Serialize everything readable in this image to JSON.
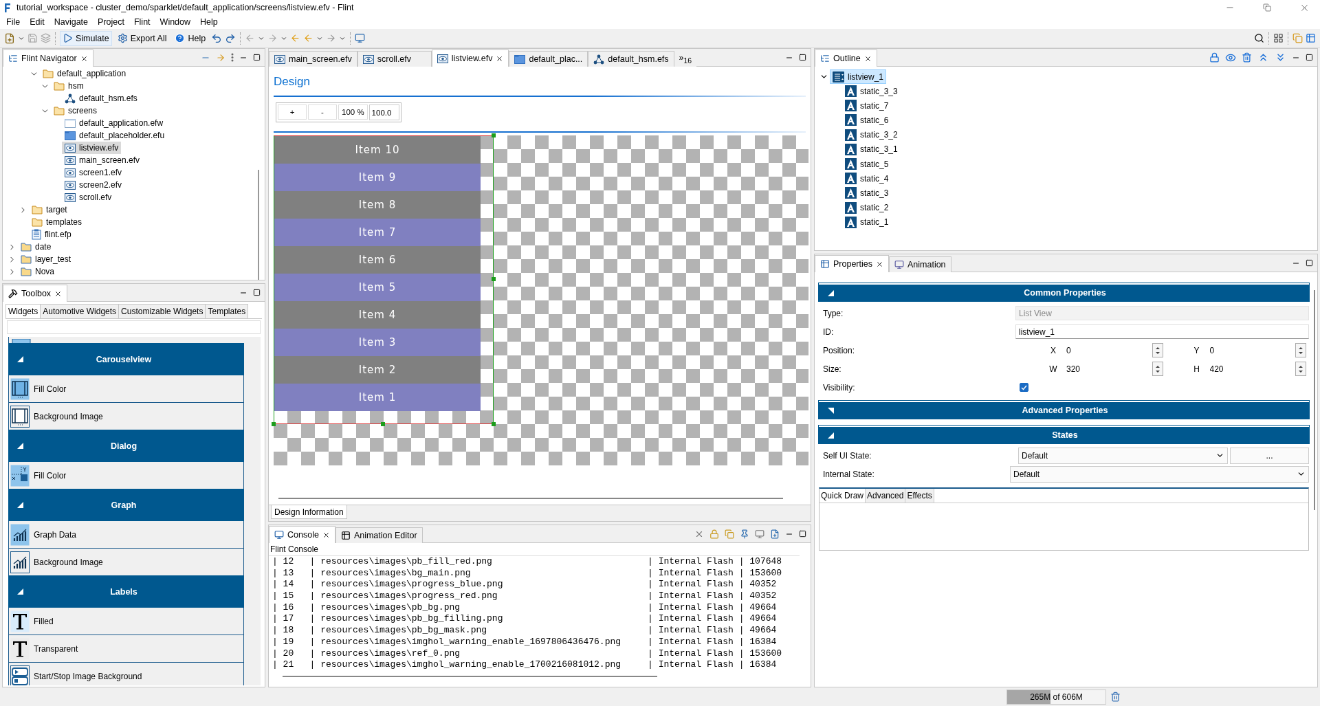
{
  "window": {
    "title": "tutorial_workspace - cluster_demo/sparklet/default_application/screens/listview.efv - Flint"
  },
  "menu": [
    "File",
    "Edit",
    "Navigate",
    "Project",
    "Flint",
    "Window",
    "Help"
  ],
  "toolbar": {
    "buttons": [
      {
        "kind": "simulate",
        "label": "Simulate"
      },
      {
        "kind": "export",
        "label": "Export All"
      },
      {
        "kind": "help",
        "label": "Help"
      }
    ]
  },
  "navigator": {
    "title": "Flint Navigator",
    "tree": [
      {
        "children": [
          {
            "children": [
              {
                "label": "default_application",
                "kind": "folder",
                "expanded": true,
                "selected": false,
                "children": [
                  {
                    "label": "hsm",
                    "kind": "folder",
                    "expanded": true,
                    "selected": false,
                    "children": [
                      {
                        "label": "default_hsm.efs",
                        "kind": "hsm",
                        "selected": false
                      }
                    ]
                  },
                  {
                    "label": "screens",
                    "kind": "folder",
                    "expanded": true,
                    "selected": false,
                    "children": [
                      {
                        "label": "default_application.efw",
                        "kind": "window",
                        "selected": false
                      },
                      {
                        "label": "default_placeholder.efu",
                        "kind": "placeholder",
                        "selected": false
                      },
                      {
                        "label": "listview.efv",
                        "kind": "view",
                        "selected": true
                      },
                      {
                        "label": "main_screen.efv",
                        "kind": "view",
                        "selected": false
                      },
                      {
                        "label": "screen1.efv",
                        "kind": "view",
                        "selected": false
                      },
                      {
                        "label": "screen2.efv",
                        "kind": "view",
                        "selected": false
                      },
                      {
                        "label": "scroll.efv",
                        "kind": "view",
                        "selected": false
                      }
                    ]
                  }
                ]
              }
            ]
          },
          {
            "label": "target",
            "kind": "folder",
            "expanded": false,
            "selected": false
          },
          {
            "label": "templates",
            "kind": "folder",
            "selected": false
          },
          {
            "label": "flint.efp",
            "kind": "project",
            "selected": false
          }
        ]
      },
      {
        "label": "date",
        "kind": "project_folder",
        "expanded": false,
        "selected": false
      },
      {
        "label": "layer_test",
        "kind": "project_folder",
        "expanded": false,
        "selected": false
      },
      {
        "label": "Nova",
        "kind": "project_folder",
        "expanded": false,
        "selected": false
      }
    ]
  },
  "toolbox": {
    "title": "Toolbox",
    "tabs": [
      {
        "label": "Widgets",
        "selected": true
      },
      {
        "label": "Automotive Widgets",
        "selected": false
      },
      {
        "label": "Customizable Widgets",
        "selected": false
      },
      {
        "label": "Templates",
        "selected": false
      }
    ],
    "groups": [
      {
        "title": "Carouselview",
        "items": [
          {
            "label": "Fill Color",
            "kind": "carousel_fill"
          },
          {
            "label": "Background Image",
            "kind": "carousel_image"
          }
        ]
      },
      {
        "title": "Dialog",
        "items": [
          {
            "label": "Fill Color",
            "kind": "dialog_fill"
          }
        ]
      },
      {
        "title": "Graph",
        "items": [
          {
            "label": "Graph Data",
            "kind": "graph_fill"
          },
          {
            "label": "Background Image",
            "kind": "graph_image"
          }
        ]
      },
      {
        "title": "Labels",
        "items": [
          {
            "label": "Filled",
            "kind": "label_filled"
          },
          {
            "label": "Transparent",
            "kind": "label_transparent"
          },
          {
            "label": "Start/Stop Image Background",
            "kind": "startstop"
          }
        ]
      }
    ]
  },
  "editor": {
    "tabs": [
      {
        "label": "main_screen.efv",
        "kind": "view",
        "selected": false
      },
      {
        "label": "scroll.efv",
        "kind": "view",
        "selected": false
      },
      {
        "label": "listview.efv",
        "kind": "view",
        "selected": true
      },
      {
        "label": "default_plac...",
        "kind": "placeholder",
        "selected": false
      },
      {
        "label": "default_hsm.efs",
        "kind": "hsm",
        "selected": false
      }
    ],
    "overflow": "»$_{16}$",
    "heading": "Design",
    "zoom": {
      "buttons": [
        "+",
        "-",
        "100 %"
      ],
      "value": "100.0"
    },
    "listview": {
      "items": [
        {
          "label": "Item 10",
          "color": "#808080"
        },
        {
          "label": "Item 9",
          "color": "#8080c0"
        },
        {
          "label": "Item 8",
          "color": "#808080"
        },
        {
          "label": "Item 7",
          "color": "#8080c0"
        },
        {
          "label": "Item 6",
          "color": "#808080"
        },
        {
          "label": "Item 5",
          "color": "#8080c0"
        },
        {
          "label": "Item 4",
          "color": "#808080"
        },
        {
          "label": "Item 3",
          "color": "#8080c0"
        },
        {
          "label": "Item 2",
          "color": "#808080"
        },
        {
          "label": "Item 1",
          "color": "#8080c0"
        }
      ]
    },
    "bottom_tab": "Design Information"
  },
  "console": {
    "tabs": [
      {
        "label": "Console",
        "selected": true
      },
      {
        "label": "Animation Editor",
        "selected": false
      }
    ],
    "title": "Flint Console",
    "lines": [
      [
        "| 12",
        "| resources\\images\\pb_fill_red.png",
        "| Internal Flash",
        "| 107648"
      ],
      [
        "| 13",
        "| resources\\images\\bg_main.png",
        "| Internal Flash",
        "| 153600"
      ],
      [
        "| 14",
        "| resources\\images\\progress_blue.png",
        "| Internal Flash",
        "| 40352"
      ],
      [
        "| 15",
        "| resources\\images\\progress_red.png",
        "| Internal Flash",
        "| 40352"
      ],
      [
        "| 16",
        "| resources\\images\\pb_bg.png",
        "| Internal Flash",
        "| 49664"
      ],
      [
        "| 17",
        "| resources\\images\\pb_bg_filling.png",
        "| Internal Flash",
        "| 49664"
      ],
      [
        "| 18",
        "| resources\\images\\pb_bg_mask.png",
        "| Internal Flash",
        "| 49664"
      ],
      [
        "| 19",
        "| resources\\images\\imghol_warning_enable_1697806436476.png",
        "| Internal Flash",
        "| 16384"
      ],
      [
        "| 20",
        "| resources\\images\\ref_0.png",
        "| Internal Flash",
        "| 153600"
      ],
      [
        "| 21",
        "| resources\\images\\imghol_warning_enable_1700216081012.png",
        "| Internal Flash",
        "| 16384"
      ]
    ]
  },
  "outline": {
    "title": "Outline",
    "tree": [
      {
        "label": "listview_1",
        "expanded": true,
        "selected": true,
        "children": [
          {
            "label": "static_3_3",
            "selected": false
          },
          {
            "label": "static_7",
            "selected": false
          },
          {
            "label": "static_6",
            "selected": false
          },
          {
            "label": "static_3_2",
            "selected": false
          },
          {
            "label": "static_3_1",
            "selected": false
          },
          {
            "label": "static_5",
            "selected": false
          },
          {
            "label": "static_4",
            "selected": false
          },
          {
            "label": "static_3",
            "selected": false
          },
          {
            "label": "static_2",
            "selected": false
          },
          {
            "label": "static_1",
            "selected": false
          }
        ]
      }
    ]
  },
  "properties": {
    "tabs": [
      {
        "label": "Properties",
        "selected": true
      },
      {
        "label": "Animation",
        "selected": false
      }
    ],
    "sections": [
      {
        "title": "Common Properties",
        "expanded": true,
        "rows": [
          {
            "kind": "readonly",
            "label": "Type:",
            "value": "List View"
          },
          {
            "kind": "text",
            "label": "ID:",
            "value": "listview_1"
          },
          {
            "kind": "pair",
            "label": "Position:",
            "fields": [
              {
                "axis": "X",
                "value": "0"
              },
              {
                "axis": "Y",
                "value": "0"
              }
            ]
          },
          {
            "kind": "pair",
            "label": "Size:",
            "fields": [
              {
                "axis": "W",
                "value": "320"
              },
              {
                "axis": "H",
                "value": "420"
              }
            ]
          },
          {
            "kind": "checkbox",
            "label": "Visibility:",
            "checked": true
          }
        ]
      },
      {
        "title": "Advanced Properties",
        "expanded": false
      },
      {
        "title": "States",
        "expanded": true,
        "rows": [
          {
            "kind": "select_more",
            "label": "Self UI State:",
            "value": "Default",
            "button": "..."
          },
          {
            "kind": "select",
            "label": "Internal State:",
            "value": "Default"
          }
        ]
      }
    ],
    "subtabs": [
      {
        "label": "Quick Draw",
        "selected": true
      },
      {
        "label": "Advanced",
        "selected": false
      },
      {
        "label": "Effects",
        "selected": false
      }
    ]
  },
  "status_bar": {
    "memory": {
      "text": "265M of 606M",
      "level": 0.44
    }
  }
}
